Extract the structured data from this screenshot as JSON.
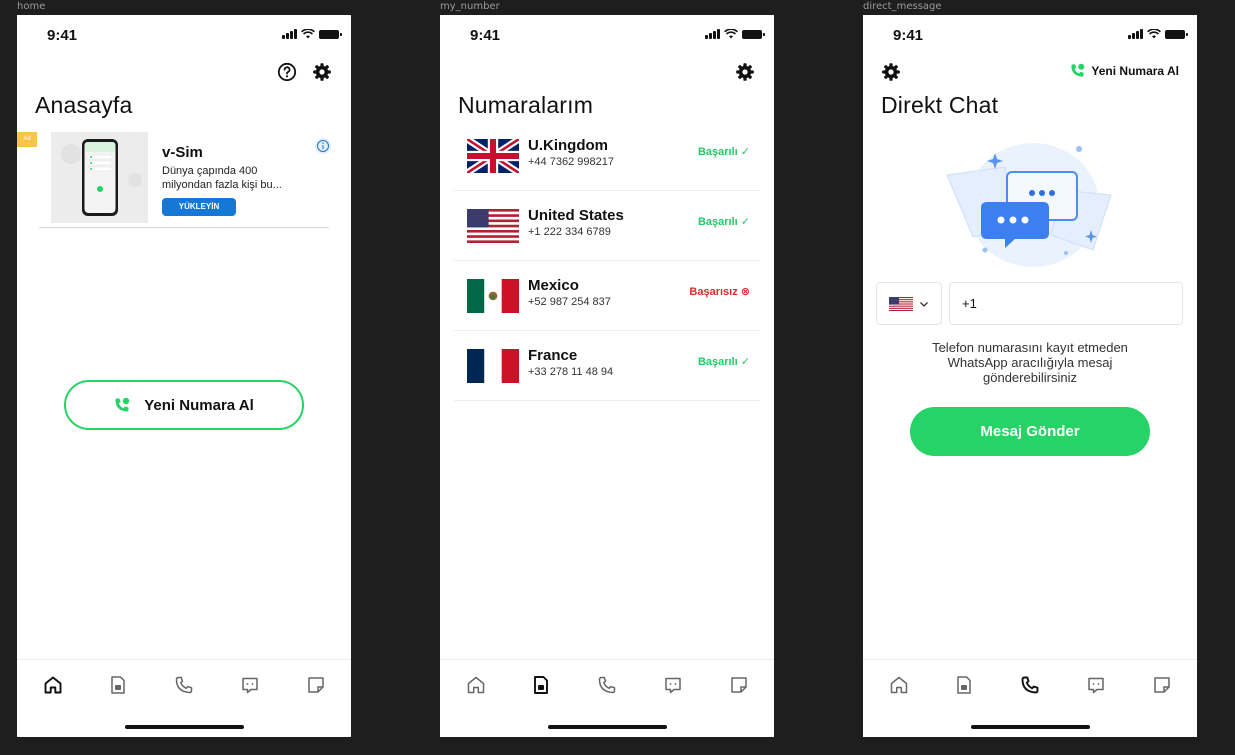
{
  "status_time": "9:41",
  "frames": {
    "home": "home",
    "my_number": "my_number",
    "direct_message": "direct_message"
  },
  "home": {
    "title": "Anasayfa",
    "ad": {
      "badge": "Ad",
      "title": "v-Sim",
      "description": "Dünya çapında 400 milyondan fazla kişi bu...",
      "button": "YÜKLEYİN"
    },
    "new_number_button": "Yeni Numara Al"
  },
  "numbers": {
    "title": "Numaralarım",
    "items": [
      {
        "country": "U.Kingdom",
        "phone": "+44 7362 998217",
        "status": "Başarılı ✓",
        "state": "success"
      },
      {
        "country": "United States",
        "phone": "+1 222 334 6789",
        "status": "Başarılı ✓",
        "state": "success"
      },
      {
        "country": "Mexico",
        "phone": "+52 987 254 837",
        "status": "Başarısız ⊗",
        "state": "fail"
      },
      {
        "country": "France",
        "phone": "+33 278 11 48 94",
        "status": "Başarılı ✓",
        "state": "success"
      }
    ]
  },
  "direct": {
    "title": "Direkt Chat",
    "header_link": "Yeni Numara Al",
    "phone_value": "+1",
    "description": "Telefon numarasını kayıt etmeden WhatsApp aracılığıyla mesaj gönderebilirsiniz",
    "send_button": "Mesaj Gönder"
  },
  "colors": {
    "accent": "#25d366",
    "ad_button": "#1577d6",
    "ad_badge": "#f6c54a",
    "fail": "#e52a2a",
    "success": "#25c866"
  },
  "tab_icons": [
    "home-icon",
    "sim-icon",
    "phone-icon",
    "chat-icon",
    "note-icon"
  ]
}
